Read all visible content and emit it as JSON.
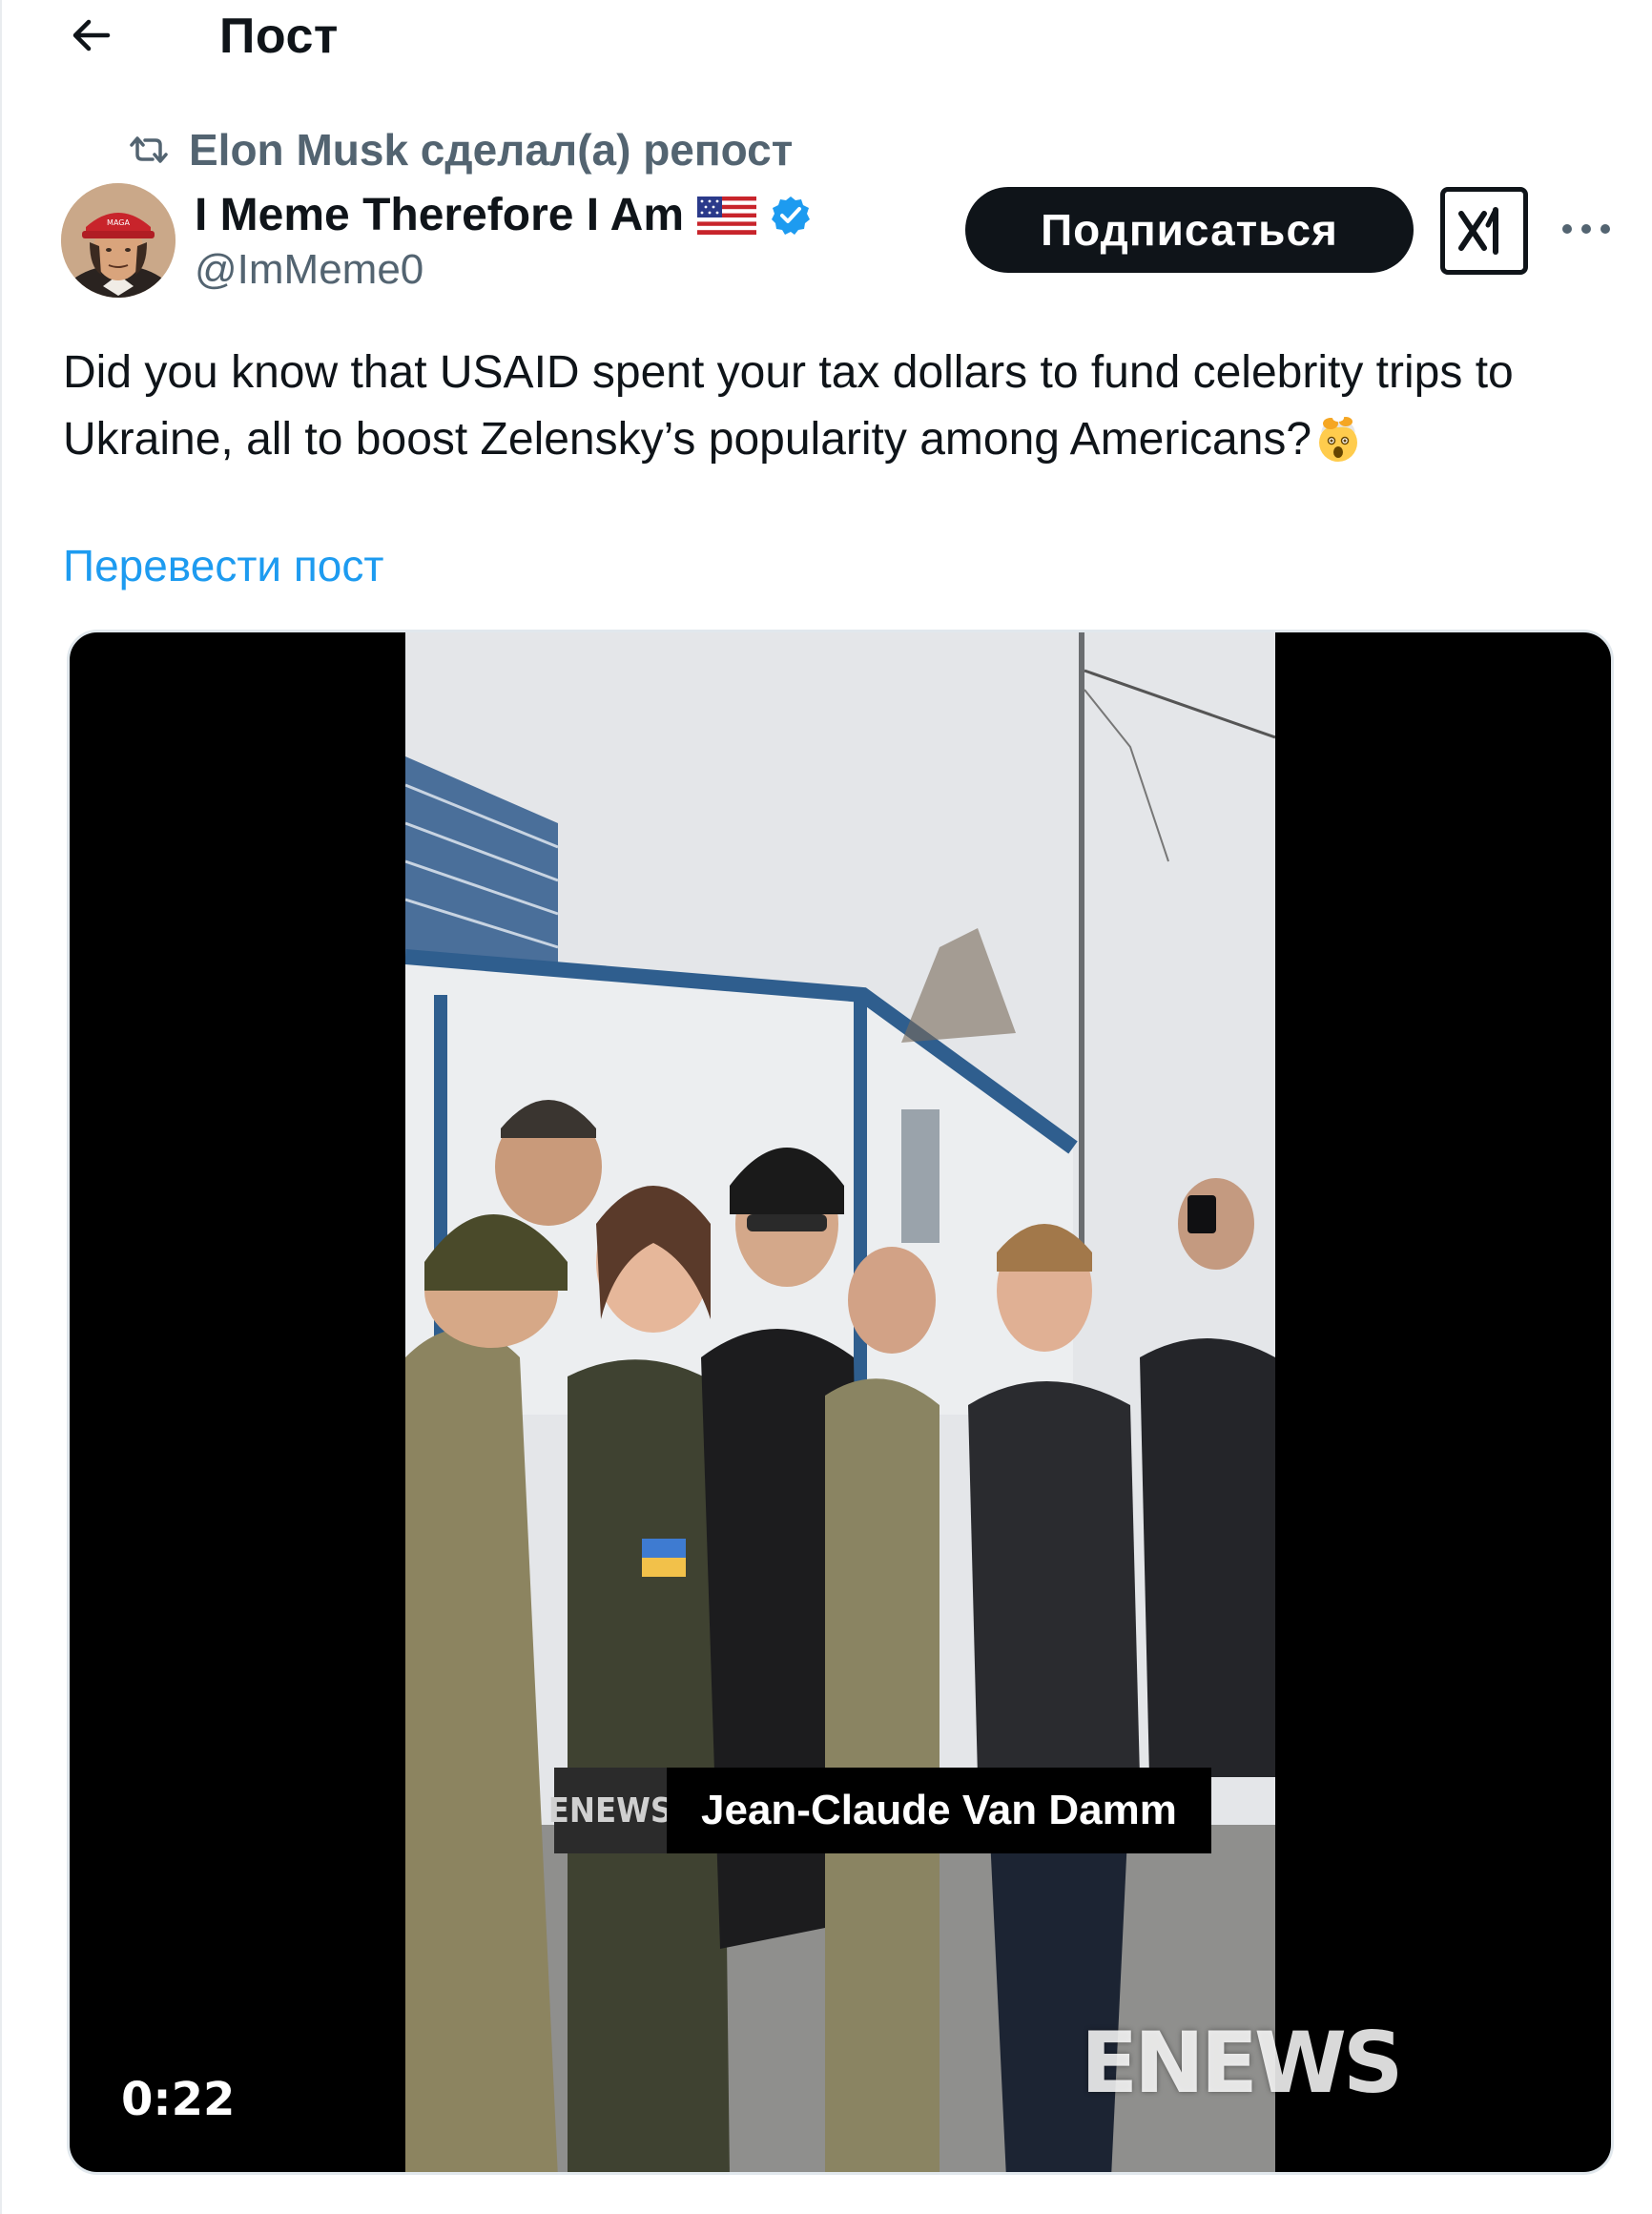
{
  "header": {
    "title": "Пост"
  },
  "repost": {
    "text": "Elon Musk сделал(а) репост"
  },
  "author": {
    "name": "I Meme Therefore I Am",
    "handle": "@ImMeme0",
    "verified": true,
    "flag": "🇺🇸"
  },
  "actions": {
    "follow_label": "Подписаться"
  },
  "tweet": {
    "text": "Did you know that USAID spent your tax dollars to fund celebrity trips to Ukraine, all to boost Zelensky’s popularity among Americans?",
    "translate_label": "Перевести пост"
  },
  "video": {
    "duration": "0:22",
    "caption_logo": "ENEWS",
    "caption": "Jean-Claude Van Damm",
    "watermark": "ENEWS"
  },
  "colors": {
    "link": "#1d9bf0",
    "verified": "#1d9bf0",
    "secondary_text": "#536471",
    "follow_bg": "#0f1419"
  }
}
